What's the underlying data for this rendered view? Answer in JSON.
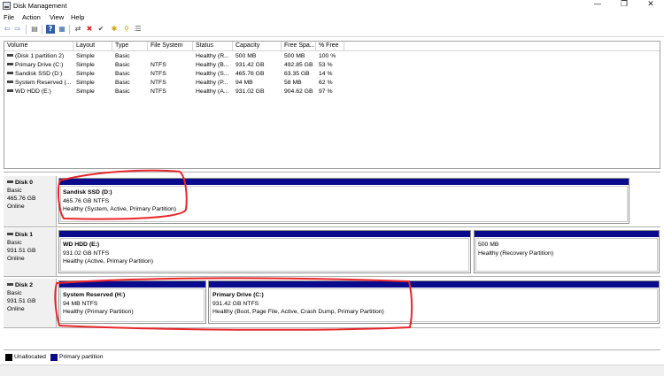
{
  "window": {
    "title": "Disk Management",
    "minimize_glyph": "—",
    "restore_glyph": "❐",
    "close_glyph": "✕"
  },
  "menu": [
    {
      "label": "File"
    },
    {
      "label": "Action"
    },
    {
      "label": "View"
    },
    {
      "label": "Help"
    }
  ],
  "toolbar": {
    "back_glyph": "⇦",
    "forward_glyph": "⇨",
    "console_glyph": "▤",
    "help_glyph": "?",
    "list_glyph": "▦",
    "connect_glyph": "⇄",
    "delete_glyph": "✖",
    "check_glyph": "✔",
    "new_glyph": "✱",
    "search_glyph": "⚲",
    "props_glyph": "☰"
  },
  "volume_list": {
    "columns": [
      "Volume",
      "Layout",
      "Type",
      "File System",
      "Status",
      "Capacity",
      "Free Spa...",
      "% Free"
    ],
    "rows": [
      {
        "volume": "(Disk 1 partition 2)",
        "layout": "Simple",
        "type": "Basic",
        "fs": "",
        "status": "Healthy (R...",
        "capacity": "500 MB",
        "free": "500 MB",
        "pct": "100 %"
      },
      {
        "volume": "Primary Drive (C:)",
        "layout": "Simple",
        "type": "Basic",
        "fs": "NTFS",
        "status": "Healthy (B...",
        "capacity": "931.42 GB",
        "free": "492.85 GB",
        "pct": "53 %"
      },
      {
        "volume": "Sandisk SSD (D:)",
        "layout": "Simple",
        "type": "Basic",
        "fs": "NTFS",
        "status": "Healthy (S...",
        "capacity": "465.76 GB",
        "free": "63.35 GB",
        "pct": "14 %"
      },
      {
        "volume": "System Reserved (...",
        "layout": "Simple",
        "type": "Basic",
        "fs": "NTFS",
        "status": "Healthy (P...",
        "capacity": "94 MB",
        "free": "58 MB",
        "pct": "62 %"
      },
      {
        "volume": "WD HDD (E:)",
        "layout": "Simple",
        "type": "Basic",
        "fs": "NTFS",
        "status": "Healthy (A...",
        "capacity": "931.02 GB",
        "free": "904.62 GB",
        "pct": "97 %"
      }
    ]
  },
  "disks": [
    {
      "name": "Disk 0",
      "type": "Basic",
      "size": "465.76 GB",
      "state": "Online",
      "partitions": [
        {
          "name": "Sandisk SSD  (D:)",
          "size": "465.76 GB NTFS",
          "status": "Healthy (System, Active, Primary Partition)"
        }
      ]
    },
    {
      "name": "Disk 1",
      "type": "Basic",
      "size": "931.51 GB",
      "state": "Online",
      "partitions": [
        {
          "name": "WD HDD  (E:)",
          "size": "931.02 GB NTFS",
          "status": "Healthy (Active, Primary Partition)"
        },
        {
          "name": "",
          "size": "500 MB",
          "status": "Healthy (Recovery Partition)"
        }
      ]
    },
    {
      "name": "Disk 2",
      "type": "Basic",
      "size": "931.51 GB",
      "state": "Online",
      "partitions": [
        {
          "name": "System Reserved  (H:)",
          "size": "94 MB NTFS",
          "status": "Healthy (Primary Partition)"
        },
        {
          "name": "Primary Drive  (C:)",
          "size": "931.42 GB NTFS",
          "status": "Healthy (Boot, Page File, Active, Crash Dump, Primary Partition)"
        }
      ]
    }
  ],
  "legend": [
    {
      "label": "Unallocated",
      "color": "#000000"
    },
    {
      "label": "Primary partition",
      "color": "#0a0a8c"
    }
  ],
  "colors": {
    "partition_bar": "#0a0a8c",
    "annotation": "#e8262a"
  }
}
